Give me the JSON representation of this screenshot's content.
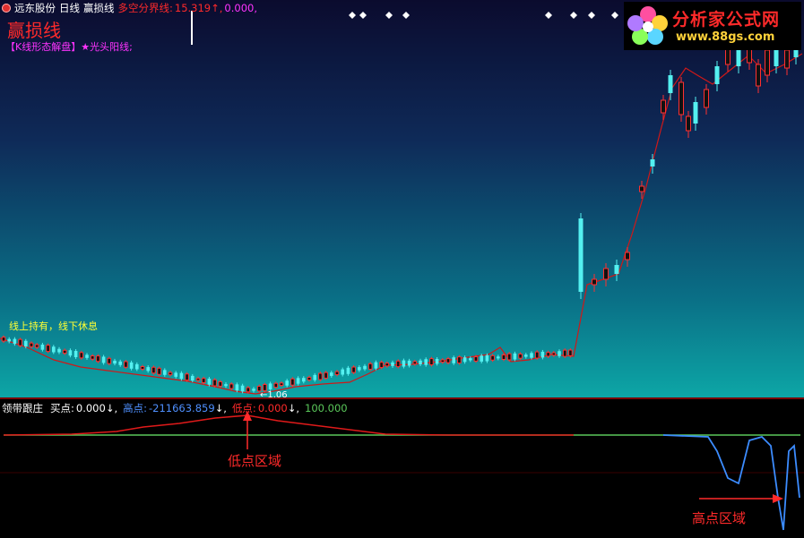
{
  "header": {
    "stock_name": "远东股份",
    "period": "日线",
    "indicator_name": "赢损线",
    "dividing_label": "多空分界线:",
    "dividing_value": "15.319",
    "dividing_arrow": "↑",
    "second_value": "0.000"
  },
  "title": "赢损线",
  "legend": {
    "pattern": "【K线形态解盘】",
    "star_label": "★光头阳线;"
  },
  "hint": "线上持有，线下休息",
  "min_price_label": "←1.06",
  "watermark": {
    "brand": "分析家公式网",
    "url": "www.88gs.com"
  },
  "sub_indicator": {
    "name": "领带跟庄",
    "buy_label": "买点:",
    "buy_value": "0.000",
    "high_label": "高点:",
    "high_value": "-211663.859",
    "low_label": "低点:",
    "low_value": "0.000",
    "fourth_value": "100.000",
    "down_arrow": "↓"
  },
  "annotations": {
    "low_zone": "低点区域",
    "high_zone": "高点区域"
  },
  "colors": {
    "header_white": "#ffffff",
    "header_red": "#ff2a2a",
    "header_magenta": "#ff33ff",
    "header_yellow": "#ffff33",
    "candle_up": "#ff3030",
    "candle_down": "#54f0f0",
    "line_red": "#d01818",
    "line_blue": "#3c8cff",
    "line_green": "#5ac85a"
  }
}
